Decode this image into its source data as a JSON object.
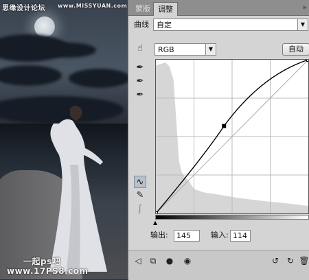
{
  "watermark": {
    "top_left": "思缘设计论坛",
    "top_url": "www.MISSYUAN.com",
    "bottom_line1": "一起ps吧",
    "bottom_line2": "www.17PS8.com"
  },
  "panel": {
    "tabs": [
      {
        "label": "蒙版",
        "active": false
      },
      {
        "label": "调整",
        "active": true
      }
    ],
    "menu_icon": "double-chevron-icon",
    "preset_label": "曲线",
    "preset_value": "自定",
    "channel_value": "RGB",
    "auto_button": "自动",
    "output_label": "输出:",
    "output_value": "145",
    "input_label": "输入:",
    "input_value": "114",
    "curve": {
      "control_points": [
        [
          0,
          0
        ],
        [
          114,
          145
        ],
        [
          255,
          255
        ]
      ],
      "range": [
        0,
        255
      ],
      "grid_divisions": 4
    },
    "colors": {
      "panel_bg": "#d4d4d4",
      "curve": "#000000",
      "histogram": "#d6d6d6"
    }
  }
}
